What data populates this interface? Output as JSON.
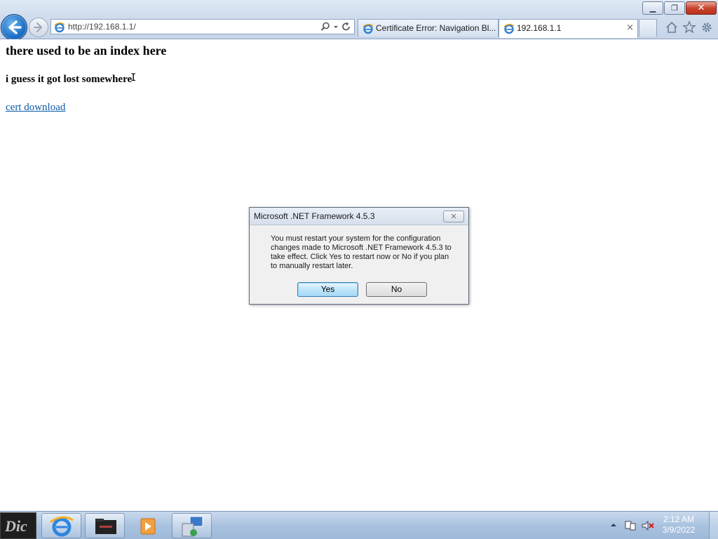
{
  "browser": {
    "address": "http://192.168.1.1/",
    "tabs": [
      {
        "label": "Certificate Error: Navigation Bl...",
        "active": false
      },
      {
        "label": "192.168.1.1",
        "active": true
      }
    ],
    "tab_close_glyph": "×",
    "window_buttons": {
      "minimize": "▁",
      "maximize": "❐",
      "close": "✕"
    },
    "icons": [
      "back-arrow-icon",
      "forward-arrow-icon",
      "ie-icon",
      "search-icon",
      "refresh-icon",
      "home-icon",
      "favorites-star-icon",
      "tools-gear-icon"
    ]
  },
  "page": {
    "heading1": "there used to be an index here",
    "heading2": "i guess it got lost somewhere",
    "link": "cert download"
  },
  "dialog": {
    "title": "Microsoft .NET Framework 4.5.3",
    "message": "You must restart your system for the configuration changes made to Microsoft .NET Framework 4.5.3 to take effect. Click Yes to restart now or No if you plan to manually restart later.",
    "yes": "Yes",
    "no": "No",
    "close_glyph": "✕"
  },
  "taskbar": {
    "start_label": "Dic",
    "time": "2:12 AM",
    "date": "3/9/2022",
    "icons": [
      "internet-explorer-icon",
      "file-explorer-icon",
      "media-player-icon",
      "network-setup-icon"
    ],
    "tray_icons": [
      "show-hidden-icons-icon",
      "network-icon",
      "volume-muted-icon"
    ],
    "colors": {
      "accent": "#1c70c7",
      "link": "#0b5aa6"
    }
  }
}
